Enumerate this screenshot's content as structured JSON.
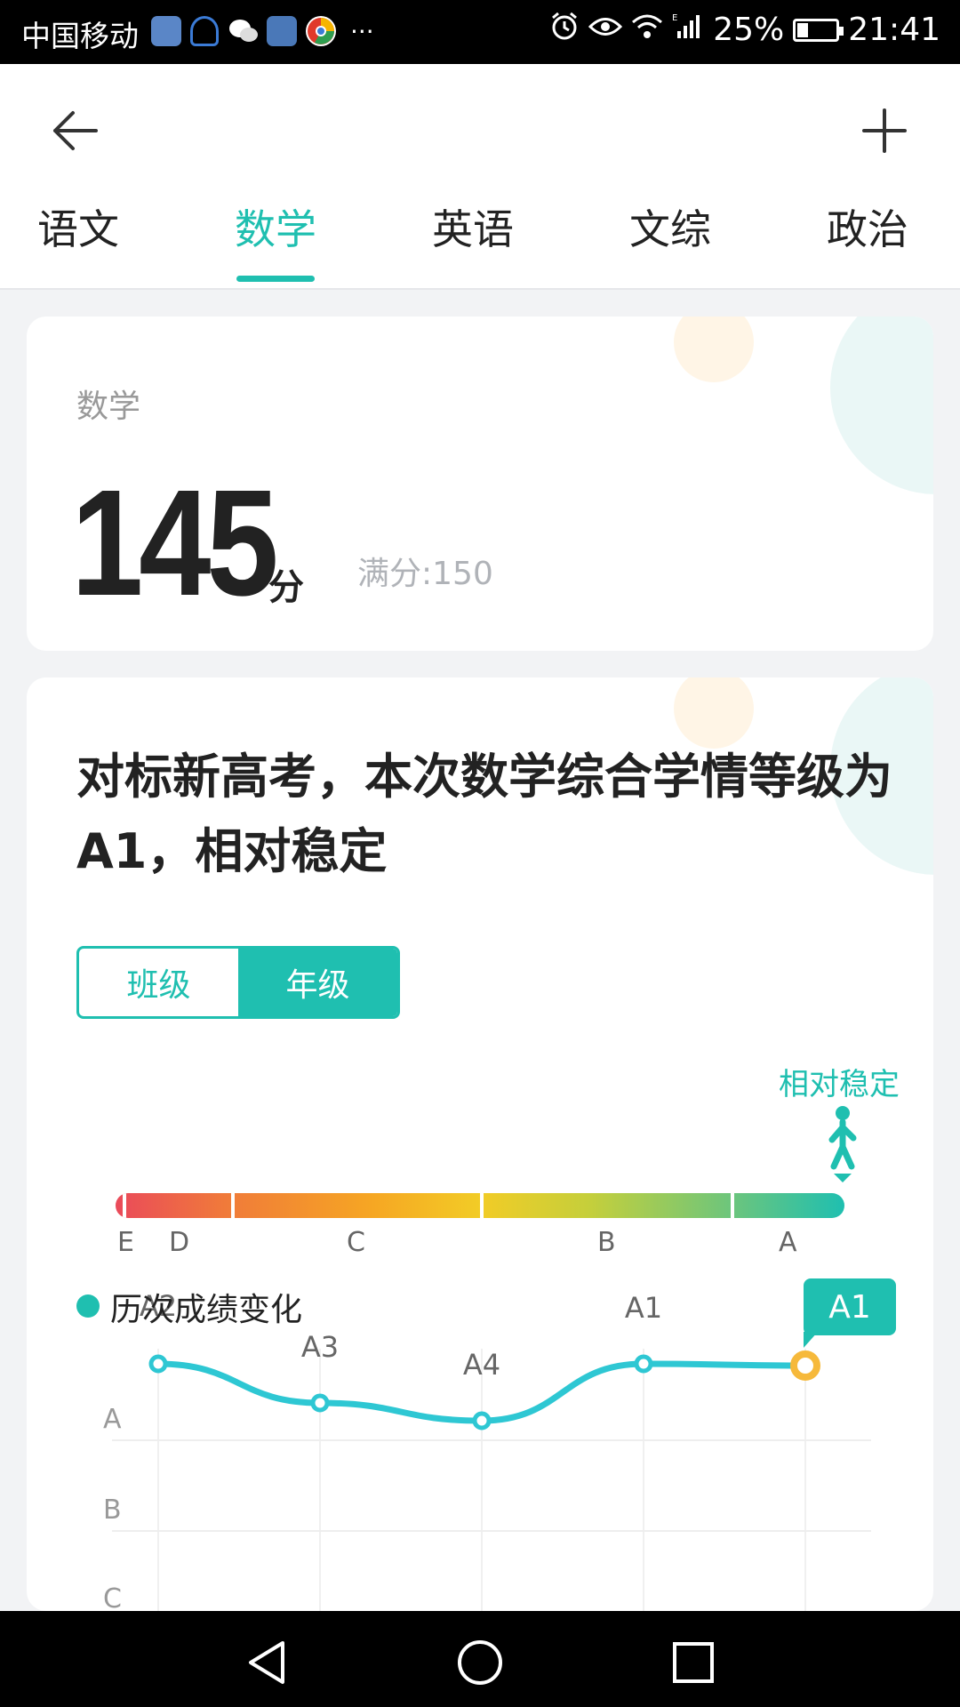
{
  "status_bar": {
    "carrier": "中国移动",
    "battery": "25%",
    "time": "21:41",
    "more": "···",
    "battery_level": 0.25
  },
  "header": {
    "back_icon": "arrow-left-icon",
    "add_icon": "plus-icon"
  },
  "tabs": [
    {
      "label": "语文"
    },
    {
      "label": "数学"
    },
    {
      "label": "英语"
    },
    {
      "label": "文综"
    },
    {
      "label": "政治"
    }
  ],
  "active_tab": "数学",
  "score_card": {
    "subject": "数学",
    "score": "145",
    "unit": "分",
    "full_score": "满分:150"
  },
  "analysis_card": {
    "headline": "对标新高考，本次数学综合学情等级为A1，相对稳定",
    "toggle": {
      "options": [
        "班级",
        "年级"
      ],
      "selected": "年级"
    },
    "stability_label": "相对稳定",
    "grade_scale": [
      "E",
      "D",
      "C",
      "B",
      "A"
    ],
    "trend": {
      "legend": "历次成绩变化",
      "points": [
        {
          "label": "A2",
          "y_grade": "A"
        },
        {
          "label": "A3",
          "y_grade": "A"
        },
        {
          "label": "A4",
          "y_grade": "A"
        },
        {
          "label": "A1",
          "y_grade": "A"
        },
        {
          "label": "A1",
          "y_grade": "A",
          "current": true
        }
      ],
      "y_axis": [
        "A",
        "B",
        "C"
      ],
      "current_badge": "A1"
    }
  },
  "colors": {
    "accent": "#1fbfb0",
    "current_point": "#f6b93b",
    "text_primary": "#222222",
    "text_secondary": "#999999"
  }
}
